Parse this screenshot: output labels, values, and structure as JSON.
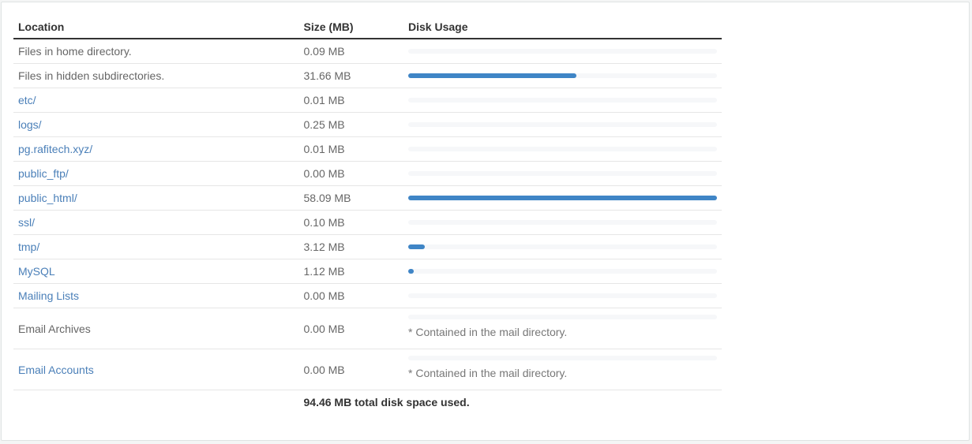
{
  "table": {
    "headers": [
      "Location",
      "Size (MB)",
      "Disk Usage"
    ],
    "bar_color": "#3f85c6",
    "rows": [
      {
        "location": "Files in home directory.",
        "link": false,
        "size": "0.09 MB",
        "usage_pct": 0.15
      },
      {
        "location": "Files in hidden subdirectories.",
        "link": false,
        "size": "31.66 MB",
        "usage_pct": 54.5
      },
      {
        "location": "etc/",
        "link": true,
        "size": "0.01 MB",
        "usage_pct": 0.02
      },
      {
        "location": "logs/",
        "link": true,
        "size": "0.25 MB",
        "usage_pct": 0.4
      },
      {
        "location": "pg.rafitech.xyz/",
        "link": true,
        "size": "0.01 MB",
        "usage_pct": 0.02
      },
      {
        "location": "public_ftp/",
        "link": true,
        "size": "0.00 MB",
        "usage_pct": 0
      },
      {
        "location": "public_html/",
        "link": true,
        "size": "58.09 MB",
        "usage_pct": 100
      },
      {
        "location": "ssl/",
        "link": true,
        "size": "0.10 MB",
        "usage_pct": 0.17
      },
      {
        "location": "tmp/",
        "link": true,
        "size": "3.12 MB",
        "usage_pct": 5.4
      },
      {
        "location": "MySQL",
        "link": true,
        "size": "1.12 MB",
        "usage_pct": 1.9
      },
      {
        "location": "Mailing Lists",
        "link": true,
        "size": "0.00 MB",
        "usage_pct": 0
      },
      {
        "location": "Email Archives",
        "link": false,
        "size": "0.00 MB",
        "usage_pct": 0,
        "note": "* Contained in the mail directory."
      },
      {
        "location": "Email Accounts",
        "link": true,
        "size": "0.00 MB",
        "usage_pct": 0,
        "note": "* Contained in the mail directory."
      }
    ],
    "total": "94.46 MB total disk space used."
  }
}
